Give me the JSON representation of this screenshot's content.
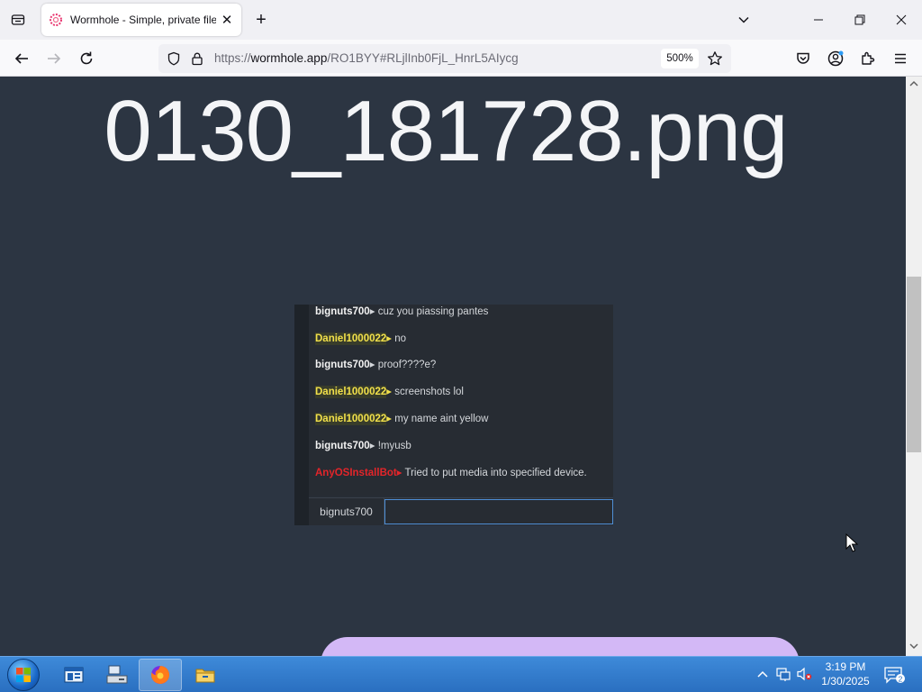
{
  "browser": {
    "tab": {
      "title": "Wormhole - Simple, private file"
    },
    "url": {
      "prefix": "https://",
      "host": "wormhole.app",
      "path": "/RO1BYY#RLjlInb0FjL_HnrL5AIycg"
    },
    "zoom": "500%"
  },
  "page": {
    "file_title": "0130_181728.png",
    "preview": {
      "messages": [
        {
          "nick": "bignuts700",
          "color": "white",
          "text": "cuz you piassing pantes"
        },
        {
          "nick": "Daniel1000022",
          "color": "yellow",
          "text": "no"
        },
        {
          "nick": "bignuts700",
          "color": "white",
          "text": "proof????e?"
        },
        {
          "nick": "Daniel1000022",
          "color": "yellow",
          "text": "screenshots lol"
        },
        {
          "nick": "Daniel1000022",
          "color": "yellow",
          "text": "my name aint yellow"
        },
        {
          "nick": "bignuts700",
          "color": "white",
          "text": "!myusb"
        },
        {
          "nick": "AnyOSInstallBot",
          "color": "red",
          "text": "Tried to put media into specified device."
        }
      ],
      "nick_box": "bignuts700"
    }
  },
  "taskbar": {
    "time": "3:19 PM",
    "date": "1/30/2025",
    "notification_count": "2"
  },
  "colors": {
    "page_bg": "#2c3542",
    "purple_button": "#d3b8f6",
    "taskbar": "#2a6fc0"
  }
}
